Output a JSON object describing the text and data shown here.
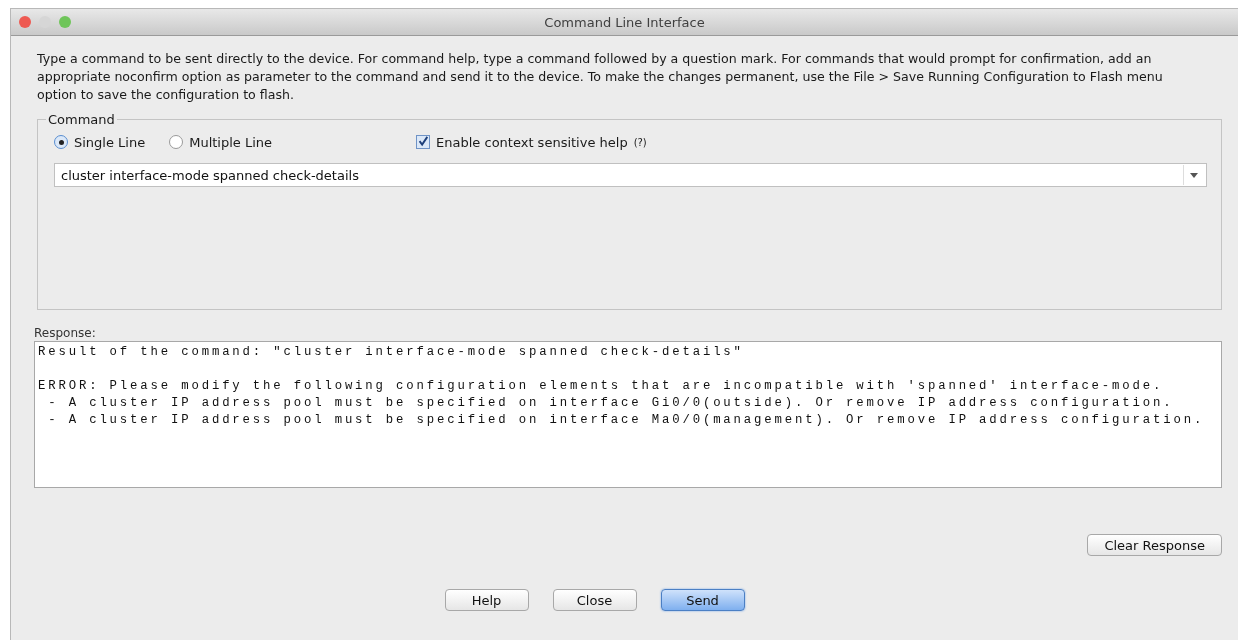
{
  "window": {
    "title": "Command Line Interface"
  },
  "intro": "Type a command to be sent directly to the device. For command help, type a command followed by a question mark. For commands that would prompt for confirmation, add an appropriate noconfirm option as parameter to the command and send it to the device. To make the changes permanent, use the File > Save Running Configuration to Flash menu option to save the configuration to flash.",
  "command": {
    "legend": "Command",
    "modes": [
      {
        "label": "Single Line",
        "selected": true
      },
      {
        "label": "Multiple Line",
        "selected": false
      }
    ],
    "context_help": {
      "label": "Enable context sensitive help",
      "hint": "(?)",
      "checked": true
    },
    "value": "cluster interface-mode spanned check-details"
  },
  "response": {
    "label": "Response:",
    "result": "Result of the command: \"cluster interface-mode spanned check-details\"",
    "lines": [
      "ERROR: Please modify the following configuration elements that are incompatible with 'spanned' interface-mode.",
      " - A cluster IP address pool must be specified on interface Gi0/0(outside). Or remove IP address configuration.",
      " - A cluster IP address pool must be specified on interface Ma0/0(management). Or remove IP address configuration."
    ],
    "clear_button": "Clear Response"
  },
  "buttons": [
    {
      "label": "Help",
      "default": false
    },
    {
      "label": "Close",
      "default": false
    },
    {
      "label": "Send",
      "default": true
    }
  ]
}
